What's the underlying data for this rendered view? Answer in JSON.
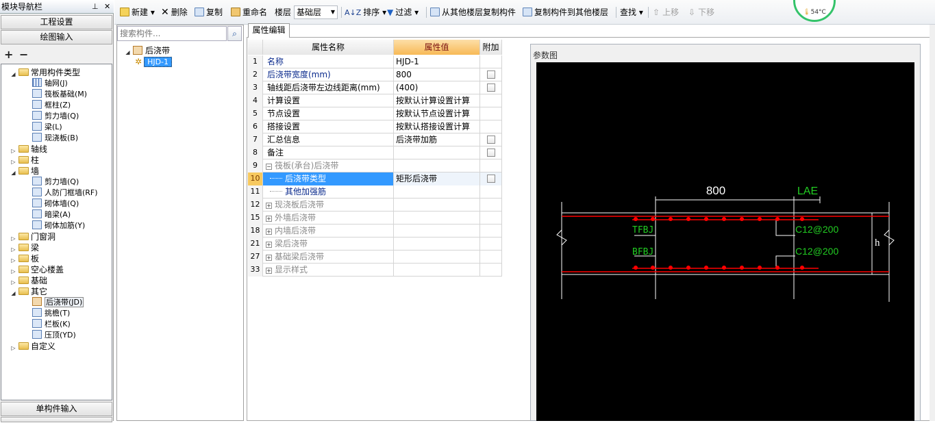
{
  "nav": {
    "title": "模块导航栏",
    "pin_glyph": "⊥",
    "close_glyph": "✕",
    "project_settings": "工程设置",
    "drawing_input": "绘图输入",
    "single_input": "单构件输入",
    "expand_all": "+",
    "collapse_all": "−",
    "tree": [
      {
        "label": "常用构件类型",
        "kind": "folder",
        "open": true
      },
      {
        "label": "轴网(J)",
        "kind": "item",
        "icon": "axis-grid-icon"
      },
      {
        "label": "筏板基础(M)",
        "kind": "item",
        "icon": "raft-foundation-icon"
      },
      {
        "label": "框柱(Z)",
        "kind": "item",
        "icon": "frame-column-icon"
      },
      {
        "label": "剪力墙(Q)",
        "kind": "item",
        "icon": "shear-wall-icon"
      },
      {
        "label": "梁(L)",
        "kind": "item",
        "icon": "beam-icon"
      },
      {
        "label": "现浇板(B)",
        "kind": "item",
        "icon": "cast-slab-icon"
      },
      {
        "label": "轴线",
        "kind": "folder",
        "open": false
      },
      {
        "label": "柱",
        "kind": "folder",
        "open": false
      },
      {
        "label": "墙",
        "kind": "folder",
        "open": true
      },
      {
        "label": "剪力墙(Q)",
        "kind": "item",
        "icon": "shear-wall-icon"
      },
      {
        "label": "人防门框墙(RF)",
        "kind": "item",
        "icon": "civil-defense-door-wall-icon"
      },
      {
        "label": "砌体墙(Q)",
        "kind": "item",
        "icon": "masonry-wall-icon"
      },
      {
        "label": "暗梁(A)",
        "kind": "item",
        "icon": "hidden-beam-icon"
      },
      {
        "label": "砌体加筋(Y)",
        "kind": "item",
        "icon": "masonry-rebar-icon"
      },
      {
        "label": "门窗洞",
        "kind": "folder",
        "open": false
      },
      {
        "label": "梁",
        "kind": "folder",
        "open": false
      },
      {
        "label": "板",
        "kind": "folder",
        "open": false
      },
      {
        "label": "空心楼盖",
        "kind": "folder",
        "open": false
      },
      {
        "label": "基础",
        "kind": "folder",
        "open": false
      },
      {
        "label": "其它",
        "kind": "folder",
        "open": true
      },
      {
        "label": "后浇带(JD)",
        "kind": "item",
        "icon": "post-pour-strip-icon",
        "selected": true
      },
      {
        "label": "挑檐(T)",
        "kind": "item",
        "icon": "eave-icon"
      },
      {
        "label": "栏板(K)",
        "kind": "item",
        "icon": "parapet-icon"
      },
      {
        "label": "压顶(YD)",
        "kind": "item",
        "icon": "coping-icon"
      },
      {
        "label": "自定义",
        "kind": "folder",
        "open": false
      }
    ]
  },
  "toolbar": {
    "new": "新建",
    "delete": "删除",
    "copy": "复制",
    "rename": "重命名",
    "floor_label": "楼层",
    "floor_value": "基础层",
    "sort": "排序",
    "filter": "过滤",
    "copy_from_floor": "从其他楼层复制构件",
    "copy_to_floor": "复制构件到其他楼层",
    "find": "查找",
    "move_up": "上移",
    "move_down": "下移"
  },
  "gauge": {
    "temperature": "54°C"
  },
  "components": {
    "search_placeholder": "搜索构件...",
    "root": "后浇带",
    "child": "HJD-1"
  },
  "properties": {
    "tab": "属性编辑",
    "headers": {
      "name": "属性名称",
      "value": "属性值",
      "extra": "附加"
    },
    "rows": [
      {
        "no": "1",
        "name": "名称",
        "value": "HJD-1",
        "style": "blue",
        "check": false,
        "indent": 0
      },
      {
        "no": "2",
        "name": "后浇带宽度(mm)",
        "value": "800",
        "style": "blue",
        "check": true,
        "indent": 0
      },
      {
        "no": "3",
        "name": "轴线距后浇带左边线距离(mm)",
        "value": "(400)",
        "style": "",
        "check": true,
        "indent": 0
      },
      {
        "no": "4",
        "name": "计算设置",
        "value": "按默认计算设置计算",
        "style": "",
        "check": false,
        "indent": 0
      },
      {
        "no": "5",
        "name": "节点设置",
        "value": "按默认节点设置计算",
        "style": "",
        "check": false,
        "indent": 0
      },
      {
        "no": "6",
        "name": "搭接设置",
        "value": "按默认搭接设置计算",
        "style": "",
        "check": false,
        "indent": 0
      },
      {
        "no": "7",
        "name": "汇总信息",
        "value": "后浇带加筋",
        "style": "",
        "check": true,
        "indent": 0
      },
      {
        "no": "8",
        "name": "备注",
        "value": "",
        "style": "",
        "check": true,
        "indent": 0
      },
      {
        "no": "9",
        "name": "筏板(承台)后浇带",
        "value": "",
        "style": "gray",
        "check": false,
        "expander": "−"
      },
      {
        "no": "10",
        "name": "后浇带类型",
        "value": "矩形后浇带",
        "style": "blue",
        "check": true,
        "indent": 1,
        "selected": true
      },
      {
        "no": "11",
        "name": "其他加强筋",
        "value": "",
        "style": "blue",
        "check": false,
        "indent": 1
      },
      {
        "no": "12",
        "name": "现浇板后浇带",
        "value": "",
        "style": "gray",
        "check": false,
        "expander": "+"
      },
      {
        "no": "15",
        "name": "外墙后浇带",
        "value": "",
        "style": "gray",
        "check": false,
        "expander": "+"
      },
      {
        "no": "18",
        "name": "内墙后浇带",
        "value": "",
        "style": "gray",
        "check": false,
        "expander": "+"
      },
      {
        "no": "21",
        "name": "梁后浇带",
        "value": "",
        "style": "gray",
        "check": false,
        "expander": "+"
      },
      {
        "no": "27",
        "name": "基础梁后浇带",
        "value": "",
        "style": "gray",
        "check": false,
        "expander": "+"
      },
      {
        "no": "33",
        "name": "显示样式",
        "value": "",
        "style": "gray",
        "check": false,
        "expander": "+"
      }
    ]
  },
  "diagram": {
    "title": "参数图",
    "width_label": "800",
    "lae_label": "LAE",
    "tfbj": "TFBJ",
    "bfbj": "BFBJ",
    "top_rebar": "C12@200",
    "bottom_rebar": "C12@200",
    "h_label": "h",
    "colors": {
      "concrete": "#ff0000",
      "label": "#22cc22",
      "line": "#ffffff"
    }
  }
}
